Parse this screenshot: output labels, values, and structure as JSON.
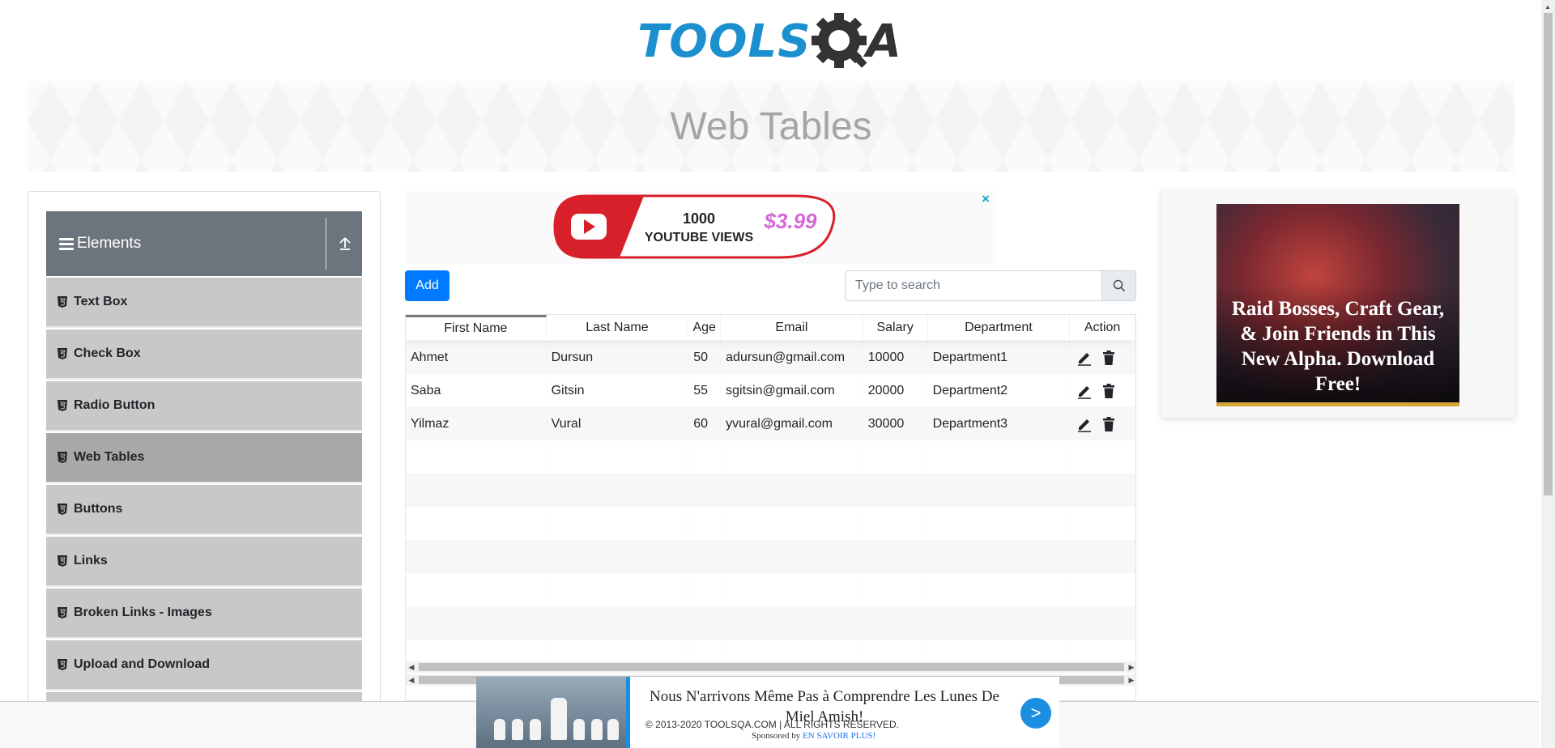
{
  "header": {
    "logo_part1": "TOOLS",
    "logo_part2": "A",
    "page_title": "Web Tables"
  },
  "sidebar": {
    "group_title": "Elements",
    "items": [
      {
        "label": "Text Box",
        "active": false
      },
      {
        "label": "Check Box",
        "active": false
      },
      {
        "label": "Radio Button",
        "active": false
      },
      {
        "label": "Web Tables",
        "active": true
      },
      {
        "label": "Buttons",
        "active": false
      },
      {
        "label": "Links",
        "active": false
      },
      {
        "label": "Broken Links - Images",
        "active": false
      },
      {
        "label": "Upload and Download",
        "active": false
      }
    ]
  },
  "ad_top": {
    "line1": "1000",
    "line2": "YOUTUBE VIEWS",
    "price": "$3.99",
    "close": "×"
  },
  "toolbar": {
    "add_label": "Add",
    "search_placeholder": "Type to search"
  },
  "table": {
    "headers": [
      "First Name",
      "Last Name",
      "Age",
      "Email",
      "Salary",
      "Department",
      "Action"
    ],
    "rows": [
      {
        "first": "Ahmet",
        "last": "Dursun",
        "age": "50",
        "email": "adursun@gmail.com",
        "salary": "10000",
        "department": "Department1"
      },
      {
        "first": "Saba",
        "last": "Gitsin",
        "age": "55",
        "email": "sgitsin@gmail.com",
        "salary": "20000",
        "department": "Department2"
      },
      {
        "first": "Yilmaz",
        "last": "Vural",
        "age": "60",
        "email": "yvural@gmail.com",
        "salary": "30000",
        "department": "Department3"
      }
    ]
  },
  "ad_right": {
    "headline": "Raid Bosses, Craft Gear, & Join Friends in This New Alpha. Download Free!"
  },
  "bottom_ad": {
    "title": "Nous N'arrivons Même Pas à Comprendre Les Lunes De Miel Amish!",
    "go": ">",
    "copyright": "© 2013-2020 TOOLSQA.COM | ALL RIGHTS RESERVED.",
    "sponsored_prefix": "Sponsored by ",
    "sponsored_link": "EN SAVOIR PLUS!"
  },
  "colors": {
    "logo_blue": "#1c8fcf",
    "logo_dark": "#333333",
    "sidebar_header": "#6c757d",
    "menu_item": "#c8c8c8",
    "menu_active": "#a8a8a8",
    "primary": "#007bff",
    "ad_blue": "#1a8fe0"
  }
}
